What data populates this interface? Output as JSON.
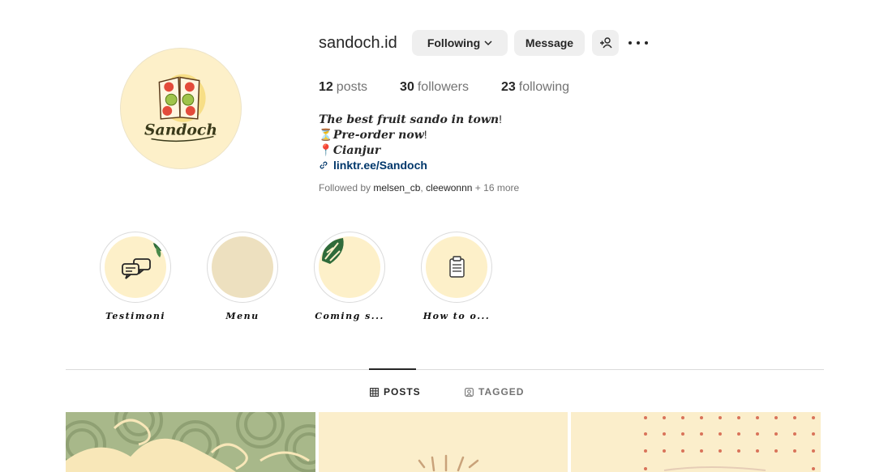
{
  "profile": {
    "username": "sandoch.id",
    "avatar_logo_text": "Sandoch"
  },
  "actions": {
    "following_label": "Following",
    "message_label": "Message"
  },
  "stats": {
    "posts_count": "12",
    "posts_label": "posts",
    "followers_count": "30",
    "followers_label": "followers",
    "following_count": "23",
    "following_label": "following"
  },
  "bio": {
    "line1_italic": "The best fruit sando in town",
    "line1_tail": "!",
    "line2_emoji": "⏳",
    "line2_italic": "Pre-order now",
    "line2_tail": "!",
    "line3_emoji": "📍",
    "line3_italic": "Cianjur",
    "link": "linktr.ee/Sandoch"
  },
  "followed_by": {
    "prefix": "Followed by",
    "user1": "melsen_cb",
    "separator": ", ",
    "user2": "cleewonnn",
    "suffix": "+ 16 more"
  },
  "highlights": [
    {
      "label": "Testimoni",
      "icon": "chat-bubbles-icon"
    },
    {
      "label": "Menu",
      "icon": "none"
    },
    {
      "label": "Coming s...",
      "icon": "monstera-leaf-icon"
    },
    {
      "label": "How to o...",
      "icon": "clipboard-icon"
    }
  ],
  "tabs": {
    "posts_label": "POSTS",
    "tagged_label": "TAGGED",
    "active": "POSTS"
  },
  "colors": {
    "cream": "#fdf0c9",
    "green_pattern": "#a8b88a",
    "link_blue": "#00376b",
    "button_grey": "#efefef",
    "dot_red": "#d9735a"
  }
}
